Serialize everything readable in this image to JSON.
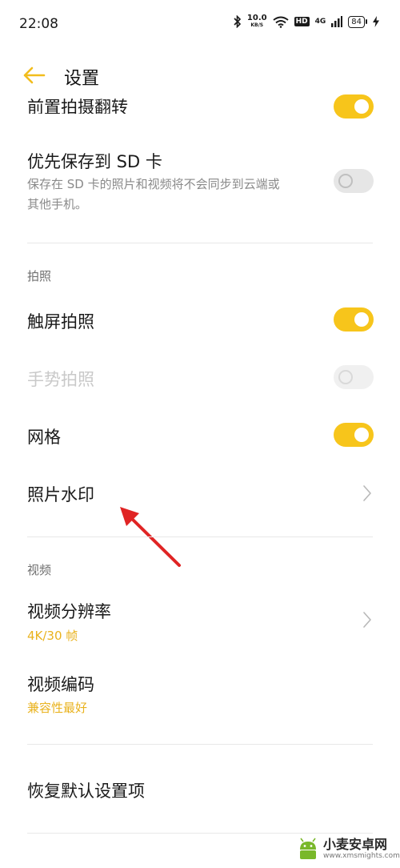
{
  "status_bar": {
    "time": "22:08",
    "net_speed": "10.0",
    "net_unit": "KB/S",
    "hd": "HD",
    "signal_label": "4G",
    "battery": "84"
  },
  "header": {
    "title": "设置",
    "back_icon": "arrow-left-icon",
    "accent_color": "#e9b21d"
  },
  "settings": {
    "front_flip": {
      "label": "前置拍摄翻转",
      "enabled": true
    },
    "save_sd": {
      "label": "优先保存到 SD 卡",
      "desc_line1": "保存在 SD 卡的照片和视频将不会同步到云端或",
      "desc_line2": "其他手机。",
      "enabled": false
    },
    "photo_section": "拍照",
    "touch_shoot": {
      "label": "触屏拍照",
      "enabled": true
    },
    "gesture_shoot": {
      "label": "手势拍照",
      "enabled": false,
      "disabled": true
    },
    "grid": {
      "label": "网格",
      "enabled": true
    },
    "watermark": {
      "label": "照片水印"
    },
    "video_section": "视频",
    "video_resolution": {
      "label": "视频分辨率",
      "value": "4K/30 帧"
    },
    "video_codec": {
      "label": "视频编码",
      "value": "兼容性最好"
    },
    "restore_defaults": {
      "label": "恢复默认设置项"
    }
  },
  "colors": {
    "toggle_on": "#f7c51b",
    "arrow": "#e02424"
  },
  "site_watermark": {
    "name": "小麦安卓网",
    "url": "www.xmsmights.com"
  }
}
